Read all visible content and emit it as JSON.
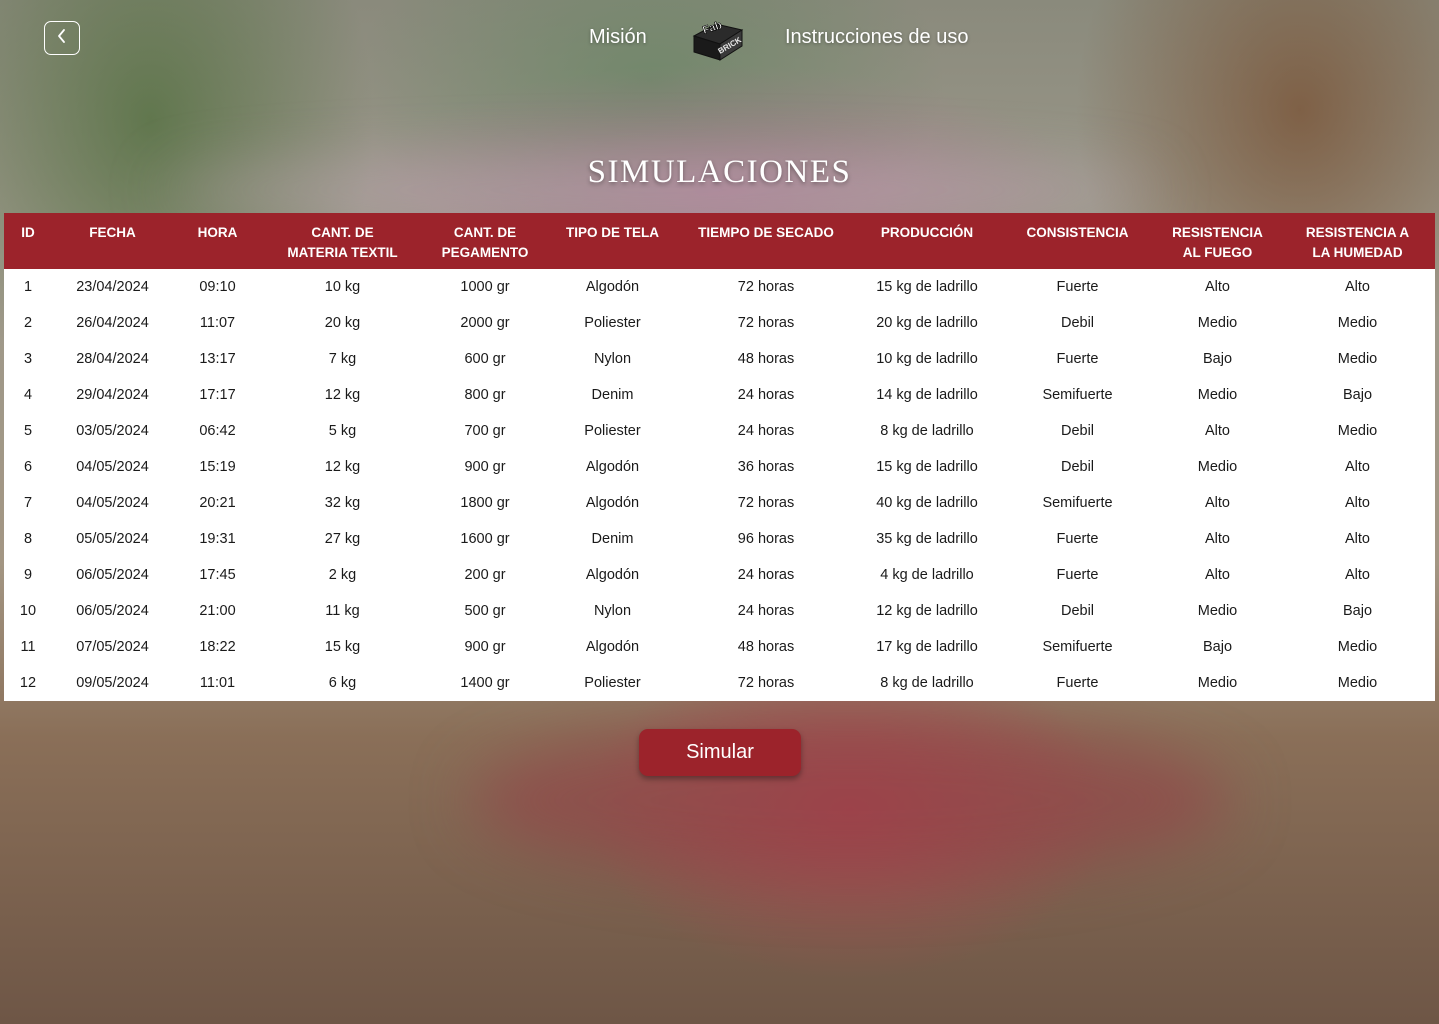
{
  "header": {
    "back_icon": "chevron-left-icon",
    "nav": {
      "mision": "Misión",
      "instrucciones": "Instrucciones de uso"
    },
    "logo": {
      "text": "FabBRICK"
    }
  },
  "page_title": "SIMULACIONES",
  "table": {
    "headers": [
      [
        "ID"
      ],
      [
        "FECHA"
      ],
      [
        "HORA"
      ],
      [
        "CANT. DE",
        "MATERIA TEXTIL"
      ],
      [
        "CANT. DE",
        "PEGAMENTO"
      ],
      [
        "TIPO DE TELA"
      ],
      [
        "TIEMPO DE SECADO"
      ],
      [
        "PRODUCCIÓN"
      ],
      [
        "CONSISTENCIA"
      ],
      [
        "RESISTENCIA",
        "AL FUEGO"
      ],
      [
        "RESISTENCIA A",
        "LA HUMEDAD"
      ]
    ],
    "rows": [
      [
        "1",
        "23/04/2024",
        "09:10",
        "10 kg",
        "1000 gr",
        "Algodón",
        "72 horas",
        "15 kg de ladrillo",
        "Fuerte",
        "Alto",
        "Alto"
      ],
      [
        "2",
        "26/04/2024",
        "11:07",
        "20 kg",
        "2000 gr",
        "Poliester",
        "72 horas",
        "20 kg de ladrillo",
        "Debil",
        "Medio",
        "Medio"
      ],
      [
        "3",
        "28/04/2024",
        "13:17",
        "7 kg",
        "600 gr",
        "Nylon",
        "48 horas",
        "10 kg de ladrillo",
        "Fuerte",
        "Bajo",
        "Medio"
      ],
      [
        "4",
        "29/04/2024",
        "17:17",
        "12 kg",
        "800 gr",
        "Denim",
        "24 horas",
        "14 kg de ladrillo",
        "Semifuerte",
        "Medio",
        "Bajo"
      ],
      [
        "5",
        "03/05/2024",
        "06:42",
        "5 kg",
        "700 gr",
        "Poliester",
        "24 horas",
        "8 kg de ladrillo",
        "Debil",
        "Alto",
        "Medio"
      ],
      [
        "6",
        "04/05/2024",
        "15:19",
        "12 kg",
        "900 gr",
        "Algodón",
        "36 horas",
        "15 kg de ladrillo",
        "Debil",
        "Medio",
        "Alto"
      ],
      [
        "7",
        "04/05/2024",
        "20:21",
        "32 kg",
        "1800 gr",
        "Algodón",
        "72 horas",
        "40 kg de ladrillo",
        "Semifuerte",
        "Alto",
        "Alto"
      ],
      [
        "8",
        "05/05/2024",
        "19:31",
        "27 kg",
        "1600 gr",
        "Denim",
        "96 horas",
        "35 kg de ladrillo",
        "Fuerte",
        "Alto",
        "Alto"
      ],
      [
        "9",
        "06/05/2024",
        "17:45",
        "2 kg",
        "200 gr",
        "Algodón",
        "24 horas",
        "4 kg de ladrillo",
        "Fuerte",
        "Alto",
        "Alto"
      ],
      [
        "10",
        "06/05/2024",
        "21:00",
        "11 kg",
        "500 gr",
        "Nylon",
        "24 horas",
        "12 kg de ladrillo",
        "Debil",
        "Medio",
        "Bajo"
      ],
      [
        "11",
        "07/05/2024",
        "18:22",
        "15 kg",
        "900 gr",
        "Algodón",
        "48 horas",
        "17 kg de ladrillo",
        "Semifuerte",
        "Bajo",
        "Medio"
      ],
      [
        "12",
        "09/05/2024",
        "11:01",
        "6 kg",
        "1400 gr",
        "Poliester",
        "72 horas",
        "8 kg de ladrillo",
        "Fuerte",
        "Medio",
        "Medio"
      ]
    ]
  },
  "simular_button": "Simular",
  "colors": {
    "accent": "#9c232b",
    "table_bg": "#ffffff",
    "text_dark": "#1a1a1a"
  }
}
